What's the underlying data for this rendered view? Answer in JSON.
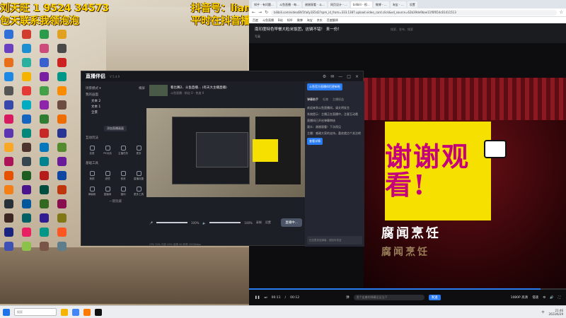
{
  "overlay": {
    "top_left_line1": "刘天旺 1 9524 34573",
    "top_left_line2": "包天联系我领泡泡",
    "top_right_line1": "抖音号：liangfengyusuo",
    "top_right_line2": "平时在抖音播 双开的斗鱼"
  },
  "desktop_icons": [
    "#2f6fd8",
    "#d23c2c",
    "#2a9b4a",
    "#e0a020",
    "#6a3fc0",
    "#1d8fd1",
    "#cc4b7a",
    "#4a4a4a",
    "#e86f1a",
    "#2bb0a0",
    "#3a5fcf",
    "#c22",
    "#1e88e5",
    "#f4b400",
    "#7b1fa2",
    "#009688",
    "#555",
    "#e53935",
    "#43a047",
    "#fb8c00",
    "#3949ab",
    "#00acc1",
    "#8e24aa",
    "#6d4c41",
    "#d81b60",
    "#1565c0",
    "#2e7d32",
    "#ef6c00",
    "#5e35b1",
    "#00897b",
    "#c62828",
    "#283593",
    "#f9a825",
    "#4e342e",
    "#0277bd",
    "#558b2f",
    "#ad1457",
    "#37474f",
    "#00838f",
    "#6a1b9a",
    "#e65100",
    "#1b5e20",
    "#b71c1c",
    "#0d47a1",
    "#f57f17",
    "#4a148c",
    "#004d40",
    "#bf360c",
    "#263238",
    "#01579b",
    "#33691e",
    "#880e4f",
    "#3e2723",
    "#006064",
    "#311b92",
    "#827717",
    "#1a237e",
    "#e91e63",
    "#009688",
    "#ff5722",
    "#3f51b5",
    "#8bc34a",
    "#795548",
    "#607d8b"
  ],
  "browser": {
    "tabs": [
      "知乎 - 有问题…",
      "斗鱼直播 - 每…",
      "谢谢观看 - 斗…",
      "网页设计 - …",
      "bilibili - 视…",
      "微博 - …",
      "淘宝 - …",
      "设置"
    ],
    "url": "bilibili.com/video/BV1fa4y1E5d2?spm_id_from=333.1387.upload.video_card.click&vd_source=62b39de9bae11f6f654c81411513",
    "bookmarks": [
      "百度",
      "斗鱼直播",
      "B站",
      "知乎",
      "微博",
      "淘宝",
      "京东",
      "百度翻译"
    ],
    "video_title": "南印度特色早餐大粒米饭团，这辆不错！ 来一份！",
    "video_tags": "搜索、发布、搜索",
    "uploader": "写真",
    "video_big_text": "谢谢观看!",
    "video_brand": "腐闻烹饪",
    "video_brand2": "腐闻烹饪",
    "progress": 0.92,
    "time_current": "00:11",
    "time_total": "00:12",
    "danmaku_placeholder": "发个友善的弹幕见证当下",
    "send_label": "发送",
    "quality": "1080P 高清",
    "speed": "倍速",
    "controls": [
      "▶",
      "⏭",
      "⚙",
      "🔊",
      "⛶"
    ]
  },
  "app": {
    "title": "直播伴侣",
    "version": "V 5.4.9",
    "window_buttons": [
      "⚙",
      "✉",
      "—",
      "□",
      "×"
    ],
    "left": {
      "scene_label": "场景模式 ▾",
      "scene_tabs": [
        "横屏",
        "竖屏"
      ],
      "scenes_title": "我的画面",
      "scenes": [
        "文本 2",
        "文本 1",
        "全景"
      ],
      "add_source": "添加直播画面",
      "interact_title": "互动玩法",
      "interact_items": [
        "连麦",
        "PK对战",
        "主播任务",
        "更多"
      ],
      "tools_title": "基础工具",
      "tools_items": [
        "美颜",
        "滤镜",
        "音效",
        "直播设置",
        "弹幕姬",
        "直播间",
        "福利",
        "更多工具"
      ],
      "hide_all": "一键隐藏"
    },
    "room": {
      "title": "看比赛2、斗鱼直播… (有天大主播直播)",
      "subtitle": "斗鱼直播 · 粉丝 0 · 热度 0"
    },
    "mixer": {
      "mic_label": "麦克风",
      "mic_value": "100%",
      "mic_level": 1,
      "speaker_label": "扬声器",
      "speaker_value": "100%",
      "speaker_level": 1,
      "record_label": "录制",
      "settings_label": "设置",
      "go_live": "直播中..."
    },
    "footer": "CPU 30%  内存 45%  帧率 60  码率 2000kbps",
    "right": {
      "notice_badge": "斗鱼官方直播伴侣更新啦",
      "tabs": [
        "弹幕助手",
        "礼物",
        "主播权益"
      ],
      "messages": [
        "欢迎来到斗鱼直播间，请文明发言",
        "系统提示：主播正在直播中，注意互动哦",
        "直播间已开启弹幕审核",
        "观众：谢谢观看！下次再见",
        "主播：感谢大家的支持，喜欢就点个关注吧"
      ],
      "announce": "查看详情",
      "input_placeholder": "在这里发送弹幕，按回车发送"
    }
  },
  "taskbar": {
    "search_placeholder": "搜索",
    "time": "21:46",
    "date": "2023/6/29",
    "lang": "中"
  }
}
